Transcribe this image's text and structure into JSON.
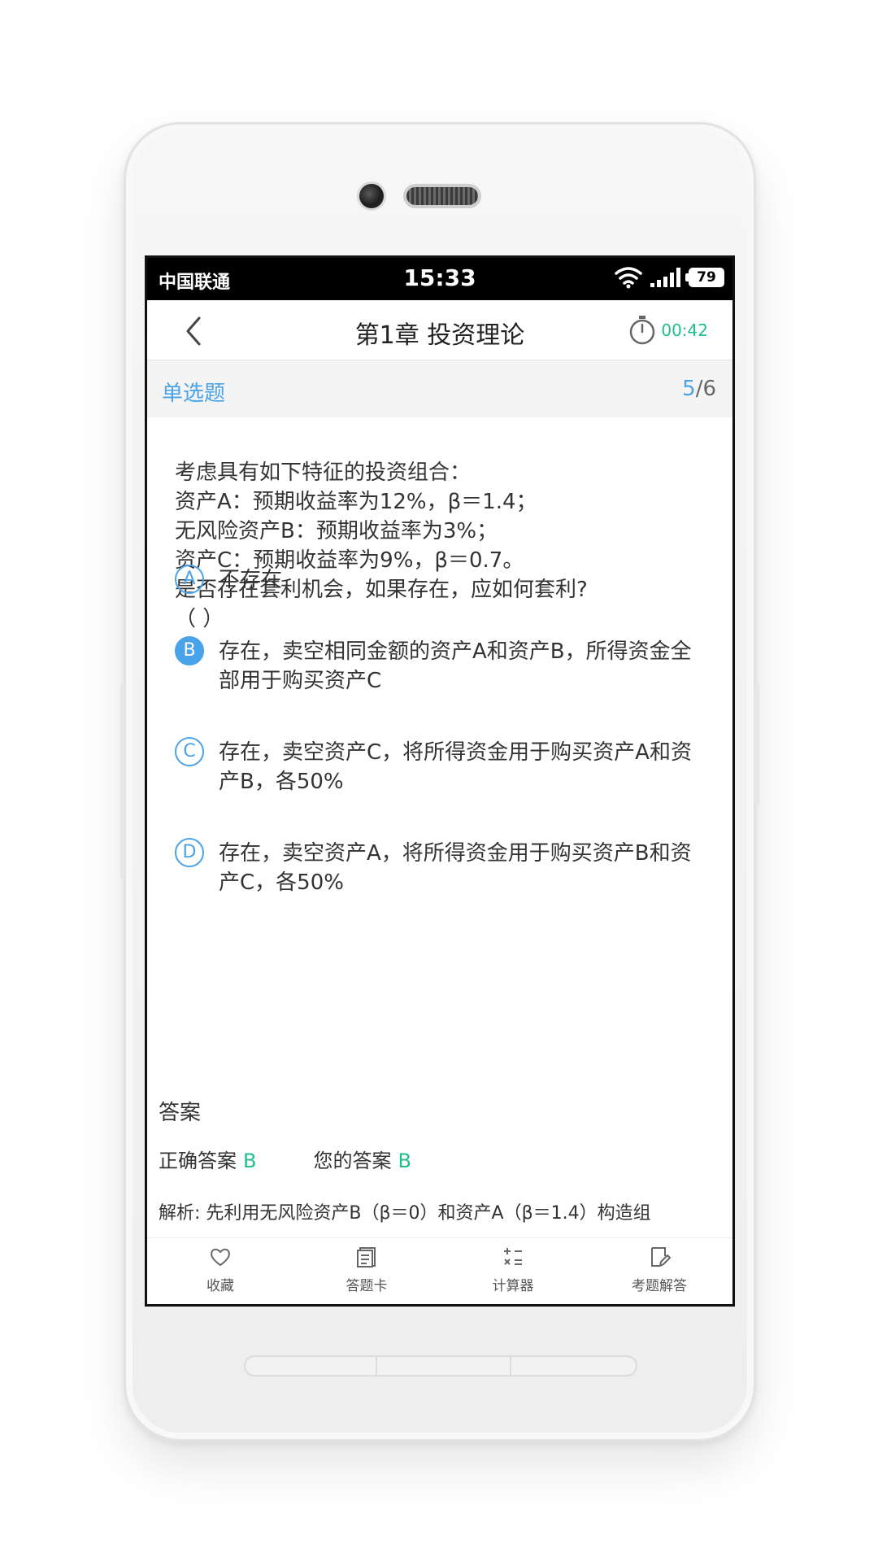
{
  "status_bar": {
    "carrier": "中国联通",
    "time": "15:33",
    "battery": "79"
  },
  "nav": {
    "title": "第1章 投资理论",
    "timer": "00:42"
  },
  "subbar": {
    "type": "单选题",
    "current": "5",
    "total": "/6"
  },
  "question": {
    "lines": [
      "考虑具有如下特征的投资组合：",
      "资产A：预期收益率为12%，β＝1.4；",
      "无风险资产B：预期收益率为3%；",
      "资产C：预期收益率为9%，β＝0.7。",
      "是否存在套利机会，如果存在，应如何套利?",
      "（ ）"
    ]
  },
  "options": [
    {
      "letter": "A",
      "text": "不存在",
      "selected": false
    },
    {
      "letter": "B",
      "text": "存在，卖空相同金额的资产A和资产B，所得资金全部用于购买资产C",
      "selected": true
    },
    {
      "letter": "C",
      "text": "存在，卖空资产C，将所得资金用于购买资产A和资产B，各50%",
      "selected": false
    },
    {
      "letter": "D",
      "text": "存在，卖空资产A，将所得资金用于购买资产B和资产C，各50%",
      "selected": false
    }
  ],
  "answer": {
    "heading": "答案",
    "correct_label": "正确答案",
    "correct_value": "B",
    "yours_label": "您的答案",
    "yours_value": "B",
    "analysis": "解析: 先利用无风险资产B（β＝0）和资产A（β＝1.4）构造组"
  },
  "tabbar": [
    {
      "label": "收藏",
      "icon": "heart-icon"
    },
    {
      "label": "答题卡",
      "icon": "answer-card-icon"
    },
    {
      "label": "计算器",
      "icon": "calculator-icon"
    },
    {
      "label": "考题解答",
      "icon": "edit-note-icon"
    }
  ],
  "colors": {
    "accent": "#4aa3e8",
    "green": "#1fbf87"
  }
}
